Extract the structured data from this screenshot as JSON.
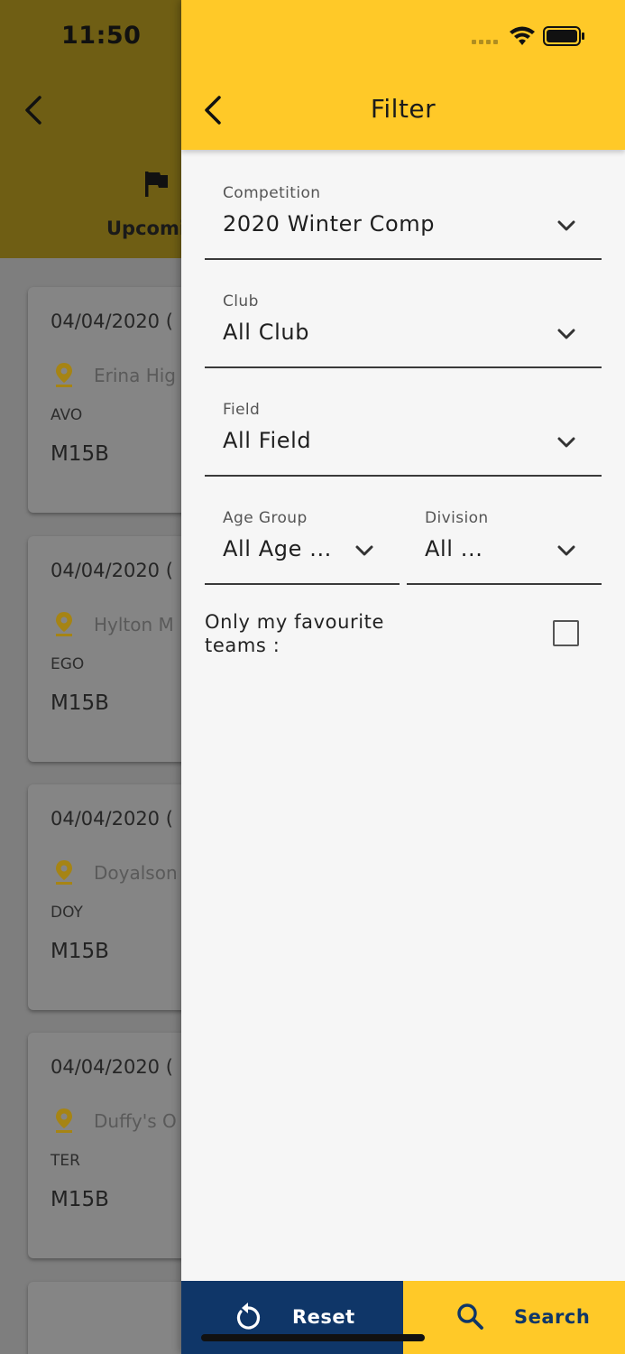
{
  "status_bar": {
    "time": "11:50"
  },
  "background": {
    "tab_label": "Upcomi",
    "cards": [
      {
        "date": "04/04/2020 (",
        "venue": "Erina Hig",
        "team": "AVO",
        "division": "M15B"
      },
      {
        "date": "04/04/2020 (",
        "venue": "Hylton M",
        "team": "EGO",
        "division": "M15B"
      },
      {
        "date": "04/04/2020 (",
        "venue": "Doyalson",
        "team": "DOY",
        "division": "M15B"
      },
      {
        "date": "04/04/2020 (",
        "venue": "Duffy's O",
        "team": "TER",
        "division": "M15B"
      }
    ]
  },
  "filter": {
    "title": "Filter",
    "competition": {
      "label": "Competition",
      "value": "2020 Winter Comp"
    },
    "club": {
      "label": "Club",
      "value": "All Club"
    },
    "field": {
      "label": "Field",
      "value": "All Field"
    },
    "age_group": {
      "label": "Age Group",
      "value": "All Age ..."
    },
    "division": {
      "label": "Division",
      "value": "All ..."
    },
    "favourite": {
      "label": "Only my favourite teams :",
      "checked": false
    },
    "reset_label": "Reset",
    "search_label": "Search"
  },
  "colors": {
    "accent": "#ffc928",
    "reset_button": "#0f3668",
    "pin": "#c9a21f"
  },
  "icons": [
    "back-icon",
    "flag-icon",
    "location-pin-icon",
    "chevron-down-icon",
    "checkbox-icon",
    "reset-icon",
    "search-icon",
    "wifi-icon",
    "battery-icon",
    "signal-icon"
  ]
}
